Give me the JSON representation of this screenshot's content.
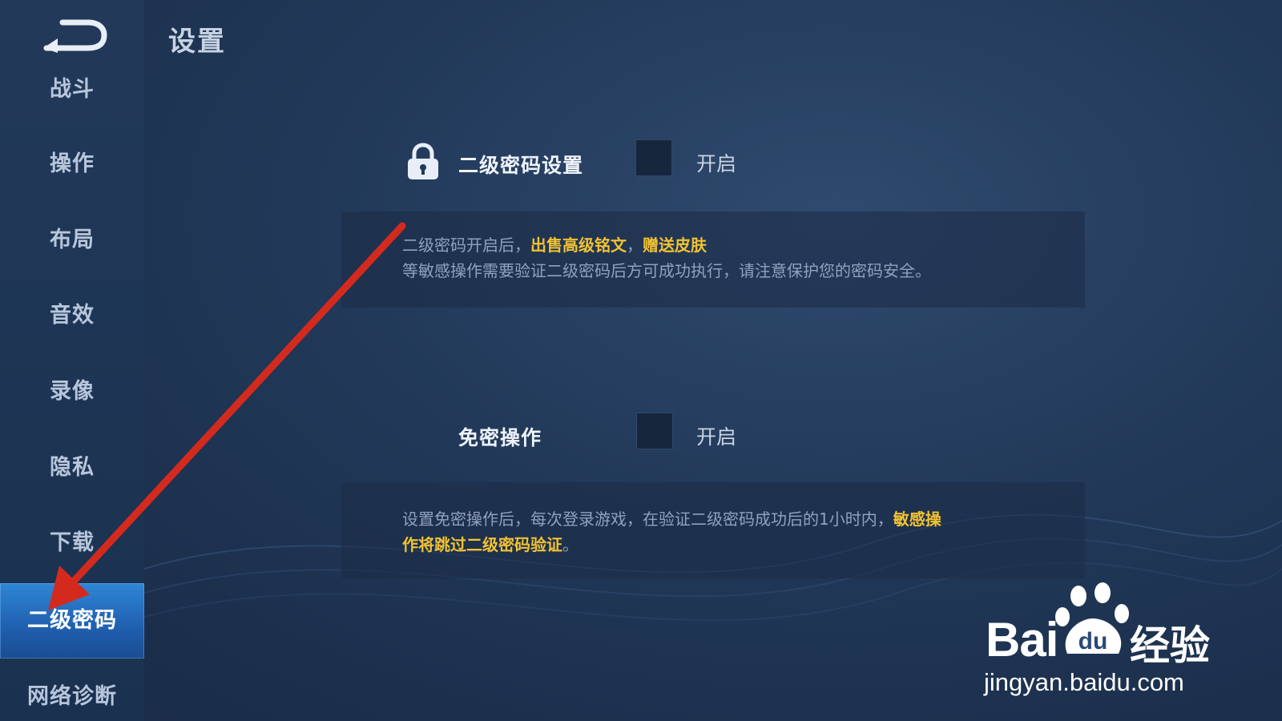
{
  "page": {
    "title": "设置"
  },
  "sidebar": {
    "items": [
      {
        "label": "战斗"
      },
      {
        "label": "操作"
      },
      {
        "label": "布局"
      },
      {
        "label": "音效"
      },
      {
        "label": "录像"
      },
      {
        "label": "隐私"
      },
      {
        "label": "下载"
      },
      {
        "label": "二级密码",
        "active": true
      },
      {
        "label": "网络诊断"
      }
    ]
  },
  "settings": {
    "secondary_password": {
      "label": "二级密码设置",
      "toggle_text": "开启",
      "checked": false,
      "desc_line1_prefix": "二级密码开启后，",
      "desc_line1_hl1": "出售高级铭文",
      "desc_line1_sep": "，",
      "desc_line1_hl2": "赠送皮肤",
      "desc_line2": "等敏感操作需要验证二级密码后方可成功执行，请注意保护您的密码安全。"
    },
    "password_free": {
      "label": "免密操作",
      "toggle_text": "开启",
      "checked": false,
      "desc_line1_prefix": "设置免密操作后，每次登录游戏，在验证二级密码成功后的1小时内，",
      "desc_line1_hl": "敏感操",
      "desc_line2_hl": "作将跳过二级密码验证",
      "desc_line2_suffix": "。"
    }
  },
  "watermark": {
    "brand_latin": "Bai",
    "brand_paw_text": "du",
    "brand_cn": "经验",
    "url": "jingyan.baidu.com"
  },
  "colors": {
    "highlight": "#f1c232",
    "active_tab": "#2f86d6",
    "arrow": "#d42a1e"
  },
  "icons": {
    "back": "back-arrow-icon",
    "lock": "lock-icon"
  }
}
